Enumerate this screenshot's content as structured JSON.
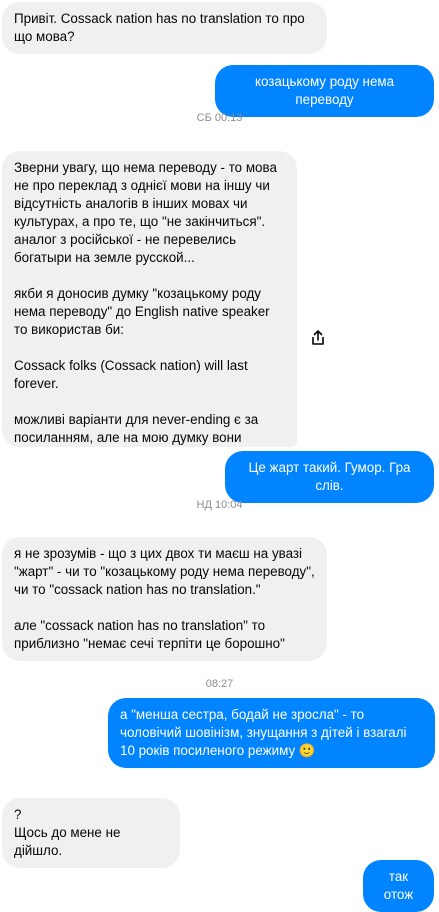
{
  "conversation": {
    "messages": [
      {
        "side": "in",
        "text": "Привіт. Cossack nation has no translation то про що мова?"
      },
      {
        "side": "out",
        "text": "козацькому роду нема переводу"
      },
      {
        "side": "in",
        "text": "Зверни увагу, що нема переводу - то мова не про переклад з однієї мови на іншу чи відсутність аналогів в інших мовах чи культурах, а про те, що \"не закінчиться\". аналог з російської - не перевелись богатыри на земле русской...\n\nякби я доносив думку \"козацькому роду нема переводу\" до English native speaker то використав би:\n\nCossack folks (Cossack nation) will last forever.\n\nможливі варіанти для never-ending є за посиланням, але на мою думку вони складніші в передачі задуманого змісту"
      },
      {
        "side": "out",
        "text": "Це жарт такий. Гумор. Гра слів."
      },
      {
        "side": "in",
        "text": "я не зрозумів - що з цих двох ти маєш на увазі \"жарт\" - чи то \"козацькому роду нема переводу\", чи то \"cossack nation has no translation.\"\n\nале \"cossack nation has no translation\" то приблизно \"немає сечі терпіти це борошно\""
      },
      {
        "side": "out",
        "text": "а \"менша сестра, бодай не зросла\" - то чоловічий шовінізм, знущання з дітей і взагалі 10 років посиленого режиму"
      },
      {
        "side": "in",
        "text": "?\nЩось до мене не дійшло."
      },
      {
        "side": "out",
        "text": "так отож"
      }
    ],
    "timestamps": [
      "СБ 00:13",
      "НД 10:04",
      "08:27"
    ],
    "emoji": "🙂"
  },
  "icons": {
    "share": "share-icon"
  },
  "colors": {
    "outgoing": "#0084ff",
    "incoming": "#f0f0f0",
    "timestamp": "#8a8d91"
  }
}
